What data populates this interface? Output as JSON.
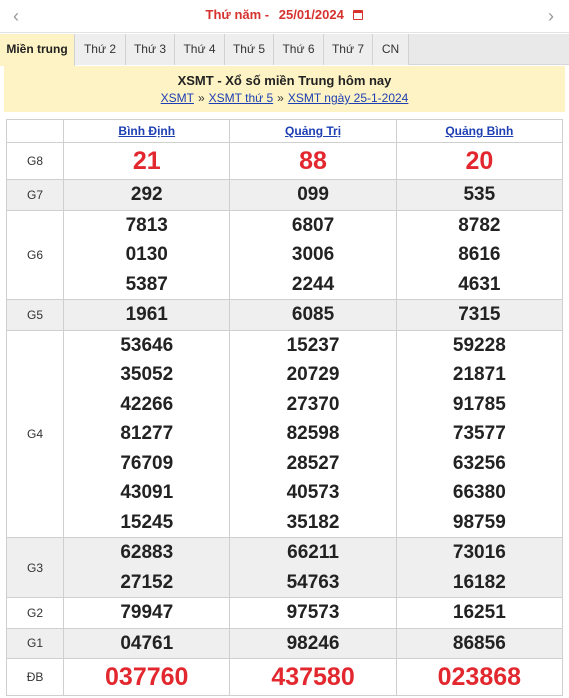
{
  "datebar": {
    "prev_icon": "chevron-left",
    "day_of_week": "Thứ năm -",
    "date": "25/01/2024",
    "calendar_icon": "calendar-icon",
    "next_icon": "chevron-right"
  },
  "tabs": [
    {
      "label": "Miền trung",
      "active": true
    },
    {
      "label": "Thứ 2"
    },
    {
      "label": "Thứ 3"
    },
    {
      "label": "Thứ 4"
    },
    {
      "label": "Thứ 5"
    },
    {
      "label": "Thứ 6"
    },
    {
      "label": "Thứ 7"
    },
    {
      "label": "CN"
    }
  ],
  "title": {
    "heading": "XSMT - Xổ số miền Trung hôm nay",
    "breadcrumb": [
      "XSMT",
      "XSMT thứ 5",
      "XSMT ngày 25-1-2024"
    ],
    "separator": "»"
  },
  "table": {
    "provinces": [
      "Bình Định",
      "Quảng Trị",
      "Quảng Bình"
    ],
    "prizes": [
      {
        "label": "G8",
        "values": [
          [
            "21"
          ],
          [
            "88"
          ],
          [
            "20"
          ]
        ]
      },
      {
        "label": "G7",
        "values": [
          [
            "292"
          ],
          [
            "099"
          ],
          [
            "535"
          ]
        ]
      },
      {
        "label": "G6",
        "values": [
          [
            "7813",
            "0130",
            "5387"
          ],
          [
            "6807",
            "3006",
            "2244"
          ],
          [
            "8782",
            "8616",
            "4631"
          ]
        ]
      },
      {
        "label": "G5",
        "values": [
          [
            "1961"
          ],
          [
            "6085"
          ],
          [
            "7315"
          ]
        ]
      },
      {
        "label": "G4",
        "values": [
          [
            "53646",
            "35052",
            "42266",
            "81277",
            "76709",
            "43091",
            "15245"
          ],
          [
            "15237",
            "20729",
            "27370",
            "82598",
            "28527",
            "40573",
            "35182"
          ],
          [
            "59228",
            "21871",
            "91785",
            "73577",
            "63256",
            "66380",
            "98759"
          ]
        ]
      },
      {
        "label": "G3",
        "values": [
          [
            "62883",
            "27152"
          ],
          [
            "66211",
            "54763"
          ],
          [
            "73016",
            "16182"
          ]
        ]
      },
      {
        "label": "G2",
        "values": [
          [
            "79947"
          ],
          [
            "97573"
          ],
          [
            "16251"
          ]
        ]
      },
      {
        "label": "G1",
        "values": [
          [
            "04761"
          ],
          [
            "98246"
          ],
          [
            "86856"
          ]
        ]
      },
      {
        "label": "ĐB",
        "values": [
          [
            "037760"
          ],
          [
            "437580"
          ],
          [
            "023868"
          ]
        ]
      }
    ]
  }
}
